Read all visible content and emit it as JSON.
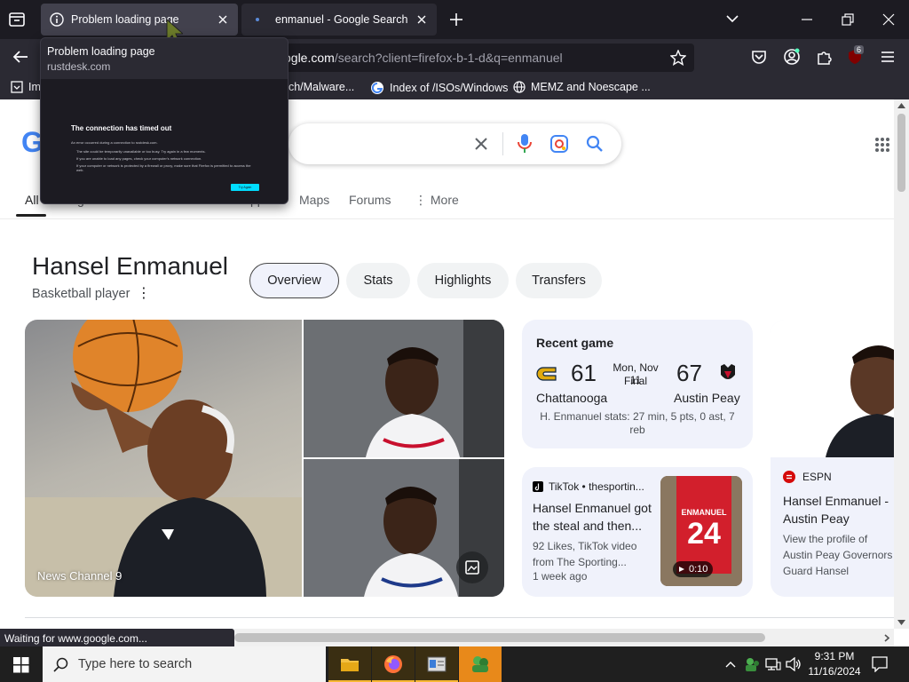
{
  "tabs": [
    {
      "label": "Problem loading page",
      "active": true
    },
    {
      "label": "enmanuel - Google Search",
      "active": false
    }
  ],
  "url": {
    "prefix": "ogle.com",
    "rest": "/search?client=firefox-b-1-d&q=enmanuel"
  },
  "extensions_badge": "6",
  "bookmarks": [
    {
      "label": "Im"
    },
    {
      "label": "nch/Malware..."
    },
    {
      "label": "Index of /ISOs/Windows"
    },
    {
      "label": "MEMZ and Noescape ..."
    }
  ],
  "preview": {
    "title": "Problem loading page",
    "host": "rustdesk.com",
    "heading": "The connection has timed out",
    "line1": "An error occurred during a connection to rustdesk.com.",
    "bullets": [
      "The site could be temporarily unavailable or too busy. Try again in a few moments.",
      "If you are unable to load any pages, check your computer's network connection.",
      "If your computer or network is protected by a firewall or proxy, make sure that Firefox is permitted to access the web."
    ],
    "button": "Try Again"
  },
  "google": {
    "logo_letter": "G",
    "nav": {
      "all": "All",
      "frag1": "g",
      "frag2": "ppi",
      "maps": "Maps",
      "forums": "Forums",
      "more": "More"
    },
    "entity": {
      "name": "Hansel Enmanuel",
      "subtitle": "Basketball player"
    },
    "pills": [
      "Overview",
      "Stats",
      "Highlights",
      "Transfers"
    ],
    "image_source": "News Channel 9",
    "recent_game": {
      "title": "Recent game",
      "team1": "Chattanooga",
      "score1": "61",
      "date": "Mon, Nov 11",
      "status": "Final",
      "team2": "Austin Peay",
      "score2": "67",
      "stats": "H. Enmanuel stats: 27 min, 5 pts, 0 ast, 7 reb"
    },
    "tiktok": {
      "source": "TikTok • thesportin...",
      "title": "Hansel Enmanuel got the steal and then...",
      "meta": "92 Likes, TikTok video from The Sporting...",
      "age": "1 week ago",
      "duration": "0:10",
      "jersey": "24",
      "jersey_name": "ENMANUEL"
    },
    "espn": {
      "source": "ESPN",
      "title": "Hansel Enmanuel - Austin Peay Governors Guard - ESPN",
      "desc": "View the profile of Austin Peay Governors Guard Hansel Enmanuel on ESPN. Get the latest news, live stats"
    }
  },
  "status_text": "Waiting for www.google.com...",
  "taskbar": {
    "search_placeholder": "Type here to search",
    "time": "9:31 PM",
    "date": "11/16/2024"
  },
  "colors": {
    "tabbar": "#1c1b22",
    "toolbar": "#2b2a33",
    "google_blue": "#4285f4",
    "card_bg": "#f0f2fb",
    "chattanooga_gold": "#e0aa0f",
    "austin_peay_red": "#c8102e",
    "espn_red": "#d50a0a"
  }
}
